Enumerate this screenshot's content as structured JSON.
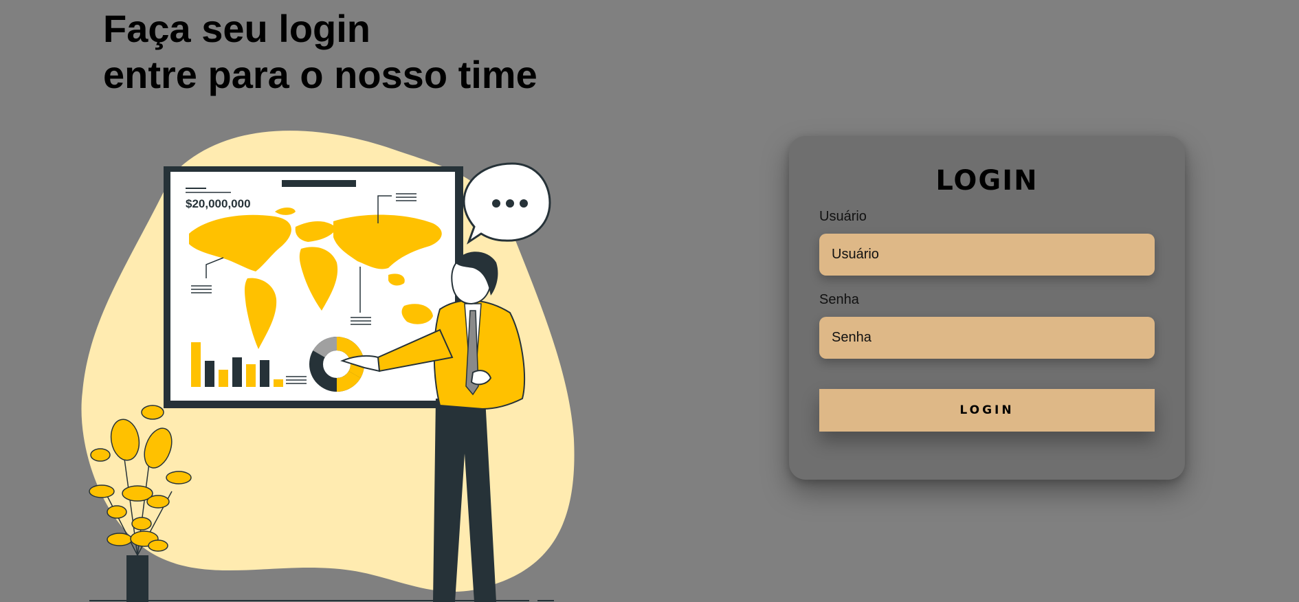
{
  "hero": {
    "title_line1": "Faça seu login",
    "title_line2": "entre para o nosso time",
    "board_amount": "$20,000,000"
  },
  "login": {
    "title": "LOGIN",
    "username_label": "Usuário",
    "username_placeholder": "Usuário",
    "password_label": "Senha",
    "password_placeholder": "Senha",
    "button_label": "LOGIN"
  },
  "colors": {
    "background": "#808080",
    "card": "#6f6f6f",
    "accent": "#deb887",
    "illustration_yellow": "#ffc100",
    "illustration_blob": "#ffebb0",
    "illustration_dark": "#263238"
  }
}
